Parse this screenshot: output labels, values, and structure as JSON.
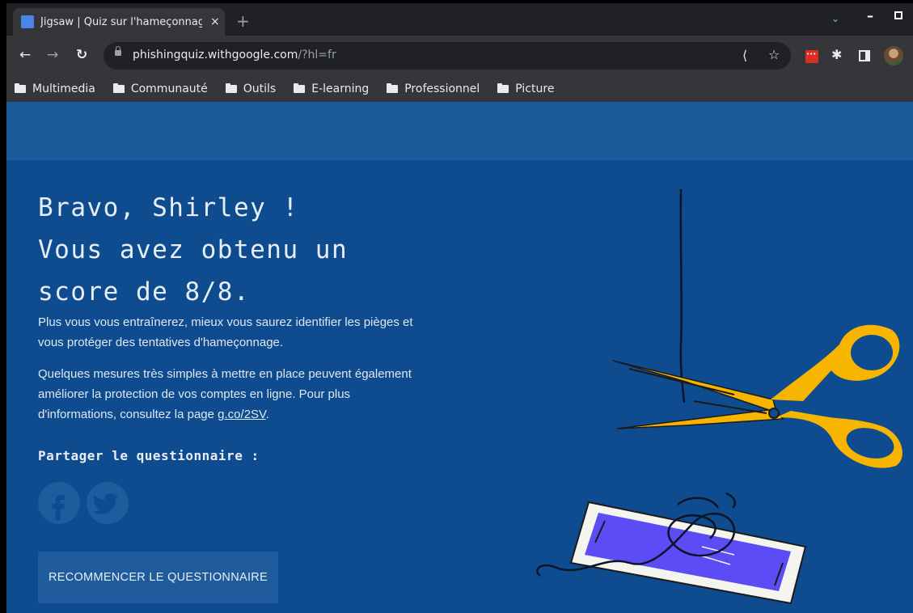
{
  "browser": {
    "tab_title": "Jigsaw | Quiz sur l'hameçonnage",
    "tab_close": "×",
    "new_tab": "+",
    "url_host": "phishingquiz.withgoogle.com",
    "url_rest": "/?hl=fr",
    "bookmarks": [
      "Multimedia",
      "Communauté",
      "Outils",
      "E-learning",
      "Professionnel",
      "Picture"
    ]
  },
  "page": {
    "title_line1": "Bravo, Shirley !",
    "title_line2": "Vous avez obtenu un",
    "title_line3": "score de 8/8.",
    "para1": "Plus vous vous entraînerez, mieux vous saurez identifier les pièges et vous protéger des tentatives d'hameçonnage.",
    "para2_text": "Quelques mesures très simples à mettre en place peuvent également améliorer la protection de vos comptes en ligne. Pour plus d'informations, consultez la page ",
    "para2_link": "g.co/2SV",
    "para2_end": ".",
    "share_title": "Partager le questionnaire :",
    "restart_label": "RECOMMENCER LE QUESTIONNAIRE"
  },
  "colors": {
    "page_bg": "#0f4c8f",
    "header_band": "#1d5a9c",
    "scissors": "#f7b500",
    "phone_screen": "#5b4cf5"
  },
  "icons": [
    "folder-icon",
    "lock-icon",
    "share-icon",
    "star-icon",
    "puzzle-icon",
    "facebook-icon",
    "twitter-icon",
    "scissors-illustration",
    "phone-illustration"
  ]
}
